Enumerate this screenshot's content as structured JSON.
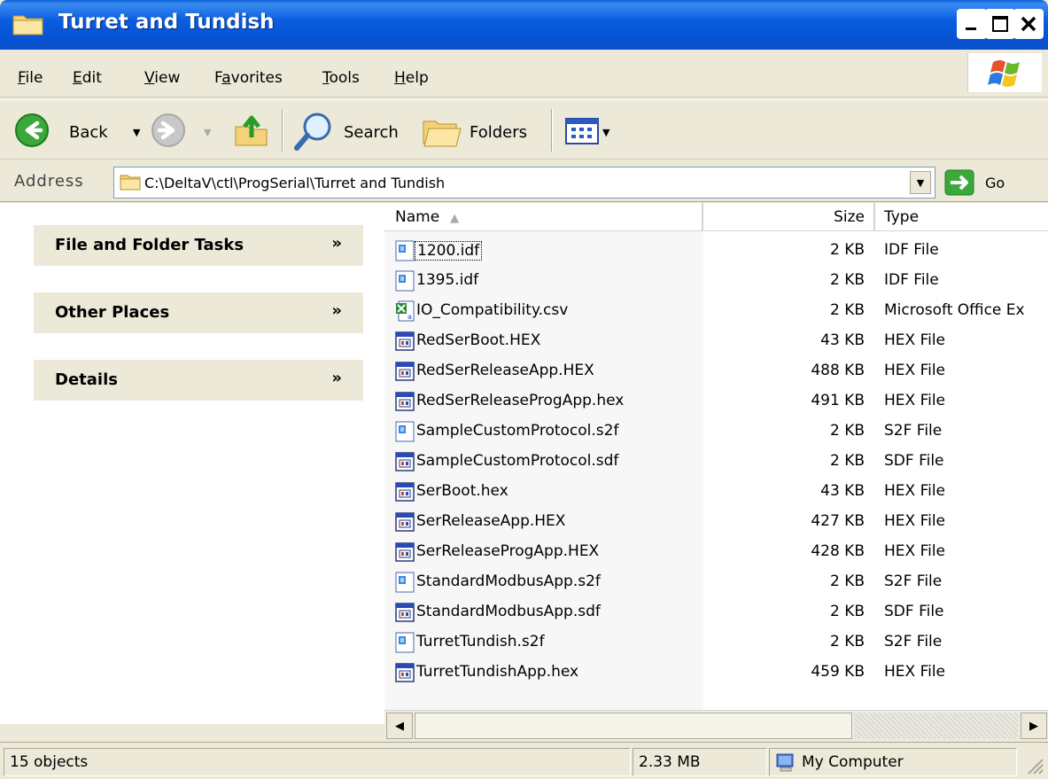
{
  "window": {
    "title": "Turret and Tundish"
  },
  "menu": {
    "items": [
      {
        "label": "File",
        "key": "F",
        "rest": "ile"
      },
      {
        "label": "Edit",
        "key": "E",
        "rest": "dit"
      },
      {
        "label": "View",
        "key": "V",
        "rest": "iew"
      },
      {
        "label": "Favorites",
        "pre": "F",
        "key": "a",
        "rest": "vorites"
      },
      {
        "label": "Tools",
        "key": "T",
        "rest": "ools"
      },
      {
        "label": "Help",
        "key": "H",
        "rest": "elp"
      }
    ]
  },
  "toolbar": {
    "back_label": "Back",
    "search_label": "Search",
    "folders_label": "Folders"
  },
  "address": {
    "label": "Address",
    "value": "C:\\DeltaV\\ctl\\ProgSerial\\Turret and Tundish",
    "go_label": "Go"
  },
  "tasks": {
    "groups": [
      {
        "title": "File and Folder Tasks"
      },
      {
        "title": "Other Places"
      },
      {
        "title": "Details"
      }
    ]
  },
  "columns": {
    "name": "Name",
    "size": "Size",
    "type": "Type"
  },
  "files": [
    {
      "name": "1200.idf",
      "size": "2 KB",
      "type": "IDF File",
      "icon": "generic-doc-icon"
    },
    {
      "name": "1395.idf",
      "size": "2 KB",
      "type": "IDF File",
      "icon": "generic-doc-icon"
    },
    {
      "name": "IO_Compatibility.csv",
      "size": "2 KB",
      "type": "Microsoft Office Ex",
      "icon": "excel-csv-icon"
    },
    {
      "name": "RedSerBoot.HEX",
      "size": "43 KB",
      "type": "HEX File",
      "icon": "hex-file-icon"
    },
    {
      "name": "RedSerReleaseApp.HEX",
      "size": "488 KB",
      "type": "HEX File",
      "icon": "hex-file-icon"
    },
    {
      "name": "RedSerReleaseProgApp.hex",
      "size": "491 KB",
      "type": "HEX File",
      "icon": "hex-file-icon"
    },
    {
      "name": "SampleCustomProtocol.s2f",
      "size": "2 KB",
      "type": "S2F File",
      "icon": "generic-doc-icon"
    },
    {
      "name": "SampleCustomProtocol.sdf",
      "size": "2 KB",
      "type": "SDF File",
      "icon": "hex-file-icon"
    },
    {
      "name": "SerBoot.hex",
      "size": "43 KB",
      "type": "HEX File",
      "icon": "hex-file-icon"
    },
    {
      "name": "SerReleaseApp.HEX",
      "size": "427 KB",
      "type": "HEX File",
      "icon": "hex-file-icon"
    },
    {
      "name": "SerReleaseProgApp.HEX",
      "size": "428 KB",
      "type": "HEX File",
      "icon": "hex-file-icon"
    },
    {
      "name": "StandardModbusApp.s2f",
      "size": "2 KB",
      "type": "S2F File",
      "icon": "generic-doc-icon"
    },
    {
      "name": "StandardModbusApp.sdf",
      "size": "2 KB",
      "type": "SDF File",
      "icon": "hex-file-icon"
    },
    {
      "name": "TurretTundish.s2f",
      "size": "2 KB",
      "type": "S2F File",
      "icon": "generic-doc-icon"
    },
    {
      "name": "TurretTundishApp.hex",
      "size": "459 KB",
      "type": "HEX File",
      "icon": "hex-file-icon"
    }
  ],
  "status": {
    "objects": "15 objects",
    "total_size": "2.33 MB",
    "zone": "My Computer"
  },
  "colors": {
    "titlebar": "#0a5ee0",
    "chrome": "#ece9d8",
    "task_header": "#ece9d8",
    "sorted_column": "#f7f7f7"
  }
}
